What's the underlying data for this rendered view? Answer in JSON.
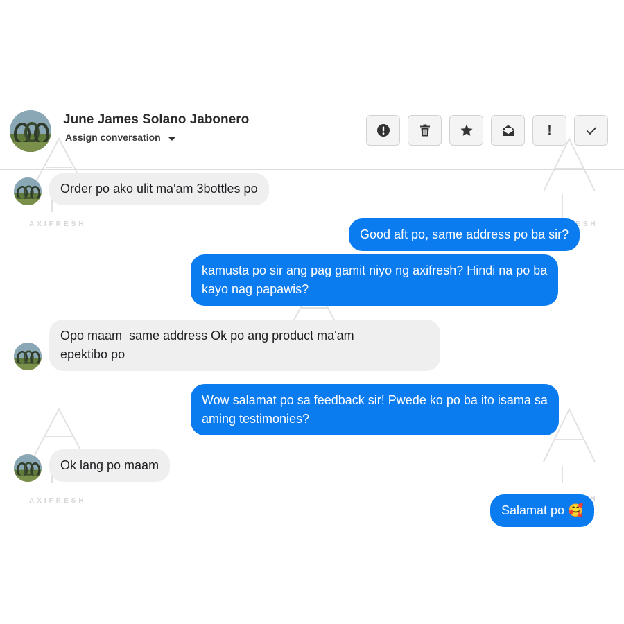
{
  "header": {
    "contact_name": "June James Solano Jabonero",
    "assign_label": "Assign conversation",
    "actions": [
      {
        "icon": "alert-circle-icon"
      },
      {
        "icon": "trash-icon"
      },
      {
        "icon": "star-icon"
      },
      {
        "icon": "mail-envelope-icon"
      },
      {
        "icon": "exclamation-icon",
        "text": "!"
      },
      {
        "icon": "checkmark-icon"
      }
    ]
  },
  "watermark": {
    "text": "AXIFRESH"
  },
  "messages": [
    {
      "direction": "incoming",
      "lines": [
        "Order po ako ulit ma'am 3bottles po"
      ]
    },
    {
      "direction": "outgoing",
      "lines": [
        "Good aft po, same address po ba sir?"
      ]
    },
    {
      "direction": "outgoing",
      "lines": [
        "kamusta po sir ang pag gamit niyo ng axifresh? Hindi na po ba",
        "kayo nag papawis?"
      ]
    },
    {
      "direction": "incoming",
      "lines": [
        "Opo maam  same address Ok po ang product ma'am",
        "epektibo po"
      ]
    },
    {
      "direction": "outgoing",
      "lines": [
        "Wow salamat po sa feedback sir! Pwede ko po ba ito isama sa",
        "aming testimonies?"
      ]
    },
    {
      "direction": "incoming",
      "lines": [
        "Ok lang po maam"
      ]
    },
    {
      "direction": "outgoing",
      "lines": [
        "Salamat po 🥰"
      ]
    }
  ],
  "colors": {
    "outgoing_bubble": "#0b7bf0",
    "incoming_bubble": "#efefef",
    "button_bg": "#f4f4f4"
  }
}
